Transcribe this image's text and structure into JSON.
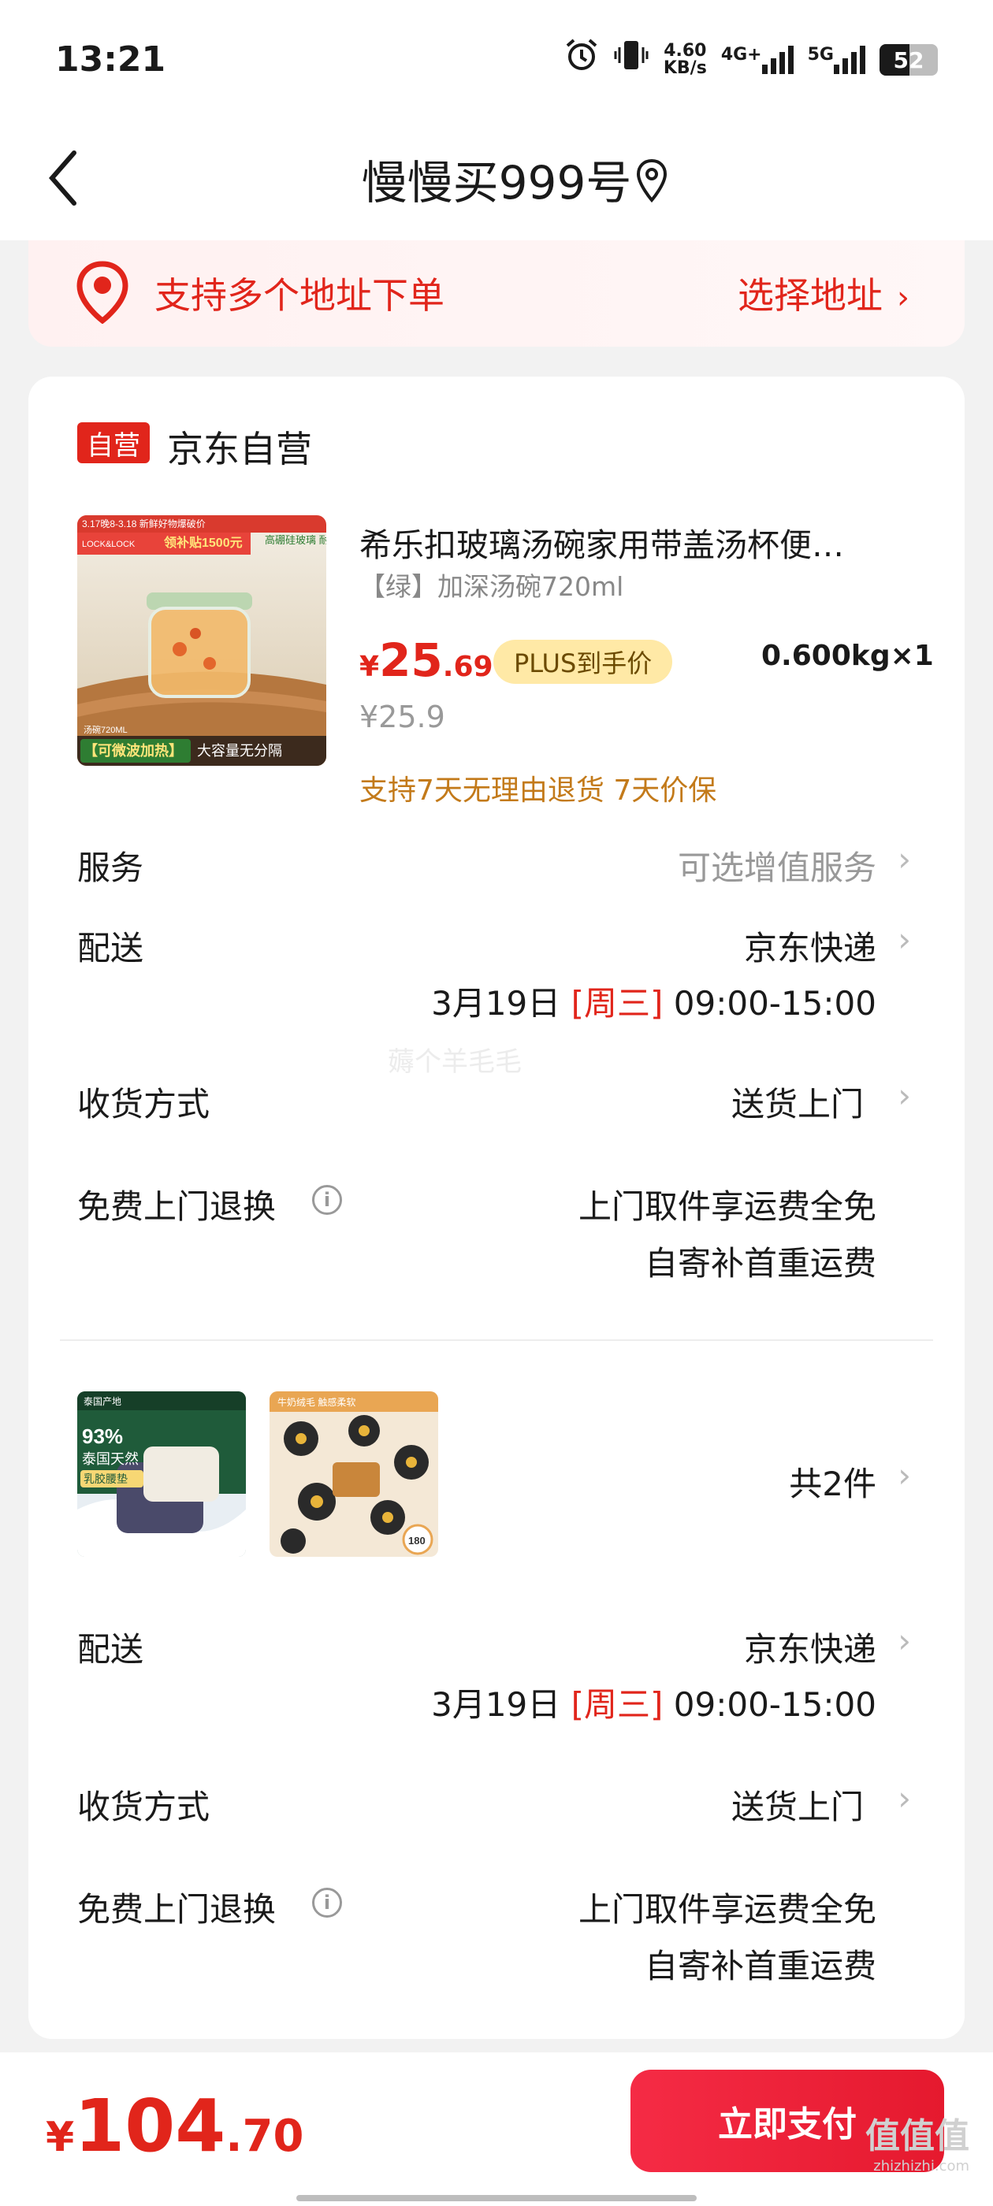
{
  "status_bar": {
    "time": "13:21",
    "speed_value": "4.60",
    "speed_unit": "KB/s",
    "net1": "4G+",
    "net2": "5G",
    "battery": "52",
    "battery_level": 0.52
  },
  "nav": {
    "title": "慢慢买999号"
  },
  "address_banner": {
    "text": "支持多个地址下单",
    "link": "选择地址",
    "chevron": "›",
    "accent_color": "#e1251b"
  },
  "shop": {
    "badge": "自营",
    "name": "京东自营"
  },
  "product": {
    "title": "希乐扣玻璃汤碗家用带盖汤杯便…",
    "spec": "【绿】加深汤碗720ml",
    "price_symbol": "¥",
    "price_int": "25",
    "price_dec": ".69",
    "plus_tag": "PLUS到手价",
    "weight": "0.600kg×1",
    "original_price": "¥25.9",
    "promises": "支持7天无理由退货  7天价保",
    "image_text": {
      "top_banner": "3.17晚8-3.18 新鲜好物爆破价",
      "subsidy": "领补贴1500元",
      "brand": "LOCK&LOCK",
      "features": "高硼硅玻璃\n耐冷耐热",
      "capacity": "汤碗720ML",
      "bottom_left": "【可微波加热】",
      "bottom_right": "大容量无分隔"
    }
  },
  "group1": {
    "service_label": "服务",
    "service_value": "可选增值服务",
    "delivery_label": "配送",
    "delivery_value": "京东快递",
    "delivery_date": "3月19日 ",
    "delivery_weekday": "[周三]",
    "delivery_time": " 09:00-15:00",
    "receive_label": "收货方式",
    "receive_value": "送货上门",
    "return_label": "免费上门退换",
    "return_value1": "上门取件享运费全免",
    "return_value2": "自寄补首重运费",
    "watermark": "薅个羊毛毛"
  },
  "group2": {
    "thumb1": {
      "tag": "泰国产地",
      "percent": "93%",
      "line1": "泰国天然",
      "line2": "乳胶腰垫"
    },
    "thumb2": {
      "tag": "牛奶绒毛 触感柔软",
      "badge": "180"
    },
    "count": "共2件",
    "delivery_label": "配送",
    "delivery_value": "京东快递",
    "delivery_date": "3月19日 ",
    "delivery_weekday": "[周三]",
    "delivery_time": " 09:00-15:00",
    "receive_label": "收货方式",
    "receive_value": "送货上门",
    "return_label": "免费上门退换",
    "return_value1": "上门取件享运费全免",
    "return_value2": "自寄补首重运费"
  },
  "footer": {
    "total_symbol": "¥",
    "total_int": "104",
    "total_dec": ".70",
    "pay_button": "立即支付",
    "watermark_main": "值值值",
    "watermark_url": "zhizhizhi.com"
  }
}
